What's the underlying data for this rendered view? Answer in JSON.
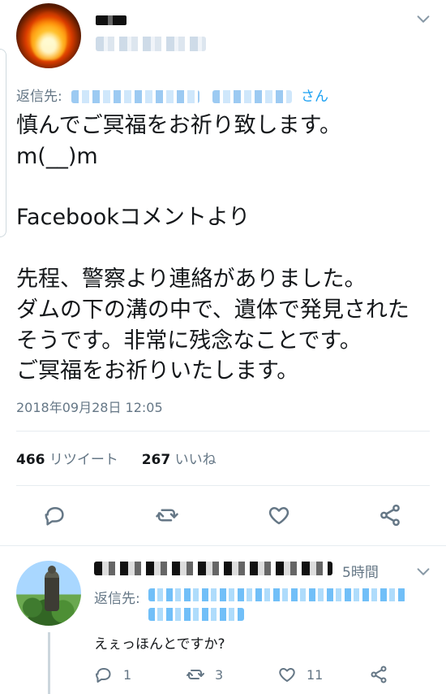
{
  "tweet": {
    "reply_prefix": "返信先:",
    "reply_suffix": "さん",
    "text": "慎んでご冥福をお祈り致します。\nm(__)m\n\nFacebookコメントより\n\n先程、警察より連絡がありました。\nダムの下の溝の中で、遺体で発見されたそうです。非常に残念なことです。\nご冥福をお祈りいたします。",
    "timestamp": "2018年09月28日 12:05",
    "retweet_count": "466",
    "retweet_label": "リツイート",
    "like_count": "267",
    "like_label": "いいね"
  },
  "reply": {
    "time": "5時間",
    "reply_prefix": "返信先:",
    "text": "えぇっほんとですか?",
    "reply_count": "1",
    "retweet_count": "3",
    "like_count": "11"
  },
  "icons": {
    "more": "chevron-down-icon",
    "reply": "reply-icon",
    "retweet": "retweet-icon",
    "like": "heart-icon",
    "share": "share-icon"
  },
  "colors": {
    "link": "#1da1f2",
    "muted": "#657786",
    "text": "#14171a"
  }
}
